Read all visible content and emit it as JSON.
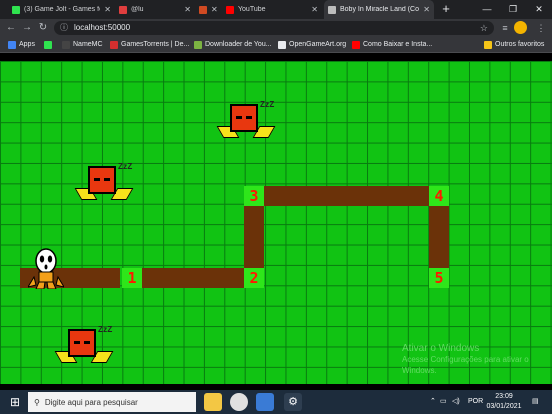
{
  "browser": {
    "tabs": [
      {
        "title": "(3) Game Jolt - Games fo...",
        "favicon_color": "#2fe34f",
        "active": false
      },
      {
        "title": "@lu",
        "favicon_color": "#e03e3e",
        "active": false
      },
      {
        "title": "",
        "favicon_color": "#d04a22",
        "active": false
      },
      {
        "title": "YouTube",
        "favicon_color": "#ff0000",
        "active": false
      },
      {
        "title": "Boby In Miracle Land (Co...",
        "favicon_color": "#bdbdbd",
        "active": true
      }
    ],
    "url": "localhost:50000",
    "bookmarks": [
      {
        "label": "Apps",
        "color": "#4285f4"
      },
      {
        "label": "",
        "color": "#2fe34f"
      },
      {
        "label": "NameMC",
        "color": "#444444"
      },
      {
        "label": "GamesTorrents | De...",
        "color": "#d32f2f"
      },
      {
        "label": "Downloader de You...",
        "color": "#7cb342"
      },
      {
        "label": "OpenGameArt.org",
        "color": "#e8eaed"
      },
      {
        "label": "Como Baixar e Insta...",
        "color": "#ff0000"
      }
    ],
    "other_bookmarks": "Outros favoritos"
  },
  "game": {
    "title_tab": "Boby In Miracle Land",
    "path_nodes": [
      "1",
      "2",
      "3",
      "4",
      "5"
    ],
    "enemies_sleeping": 3,
    "sleep_text": "Z z Z",
    "colors": {
      "grass": "#11c313",
      "grid": "#087b10",
      "path": "#6b3209",
      "node": "#2ee61a",
      "node_text": "#ff1a00",
      "enemy": "#e8370f"
    }
  },
  "watermark": {
    "line1": "Ativar o Windows",
    "line2": "Acesse Configurações para ativar o",
    "line3": "Windows."
  },
  "taskbar": {
    "search_placeholder": "Digite aqui para pesquisar",
    "language": "POR",
    "time": "23:09",
    "date": "03/01/2021"
  }
}
